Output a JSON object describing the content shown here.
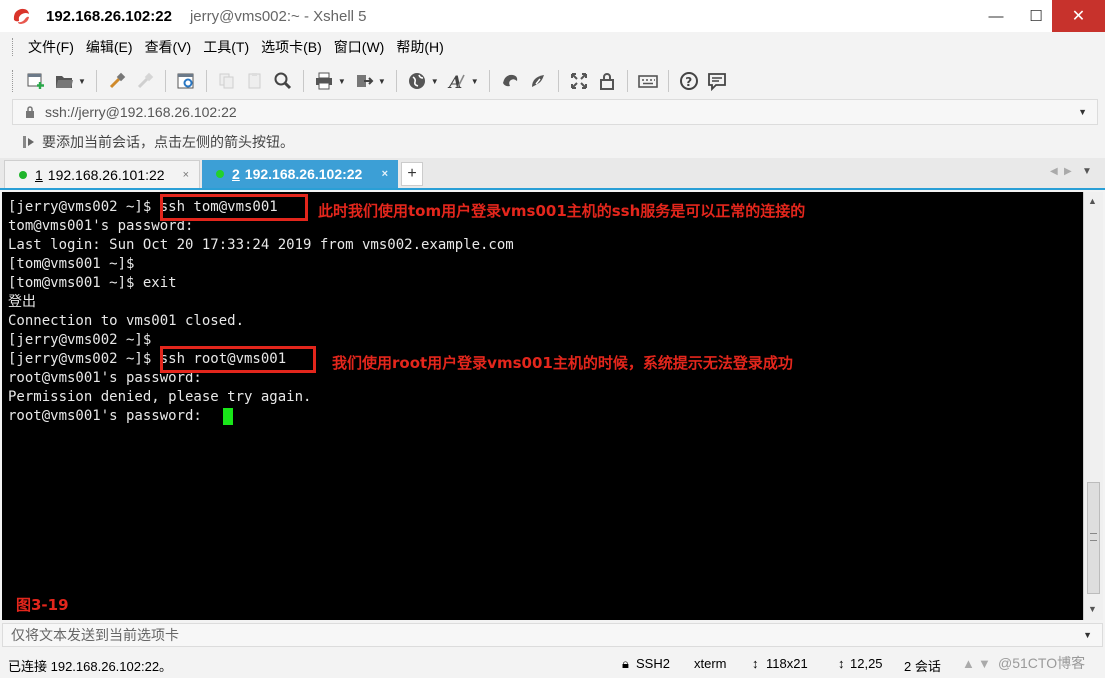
{
  "window": {
    "title_host": "192.168.26.102:22",
    "title_rest": "jerry@vms002:~ - Xshell 5",
    "minimize": "—",
    "maximize": "☐",
    "close": "✕"
  },
  "menu": [
    "文件(F)",
    "编辑(E)",
    "查看(V)",
    "工具(T)",
    "选项卡(B)",
    "窗口(W)",
    "帮助(H)"
  ],
  "address": {
    "value": "ssh://jerry@192.168.26.102:22"
  },
  "hint": "要添加当前会话，点击左侧的箭头按钮。",
  "tabs": [
    {
      "num": "1",
      "label": "192.168.26.101:22",
      "close": "×"
    },
    {
      "num": "2",
      "label": "192.168.26.102:22",
      "close": "×"
    }
  ],
  "tab_add": "+",
  "terminal": {
    "lines": [
      "[jerry@vms002 ~]$ ssh tom@vms001",
      "tom@vms001's password:",
      "Last login: Sun Oct 20 17:33:24 2019 from vms002.example.com",
      "[tom@vms001 ~]$",
      "[tom@vms001 ~]$ exit",
      "登出",
      "Connection to vms001 closed.",
      "[jerry@vms002 ~]$",
      "[jerry@vms002 ~]$ ssh root@vms001",
      "root@vms001's password:",
      "Permission denied, please try again.",
      "root@vms001's password:"
    ],
    "annotation_1": "此时我们使用tom用户登录vms001主机的ssh服务是可以正常的连接的",
    "annotation_2": "我们使用root用户登录vms001主机的时候，系统提示无法登录成功",
    "figure_label": "图3-19"
  },
  "send_bar": {
    "placeholder": "仅将文本发送到当前选项卡"
  },
  "status": {
    "connection": "已连接 192.168.26.102:22。",
    "protocol": "SSH2",
    "terminal_type": "xterm",
    "size": "118x21",
    "cursor_pos": "12,25",
    "sessions": "2 会话",
    "watermark": "@51CTO博客"
  },
  "colors": {
    "accent": "#2a9fd6",
    "annotation": "#e3261c",
    "cursor": "#19e619",
    "close_button": "#c7322c"
  }
}
